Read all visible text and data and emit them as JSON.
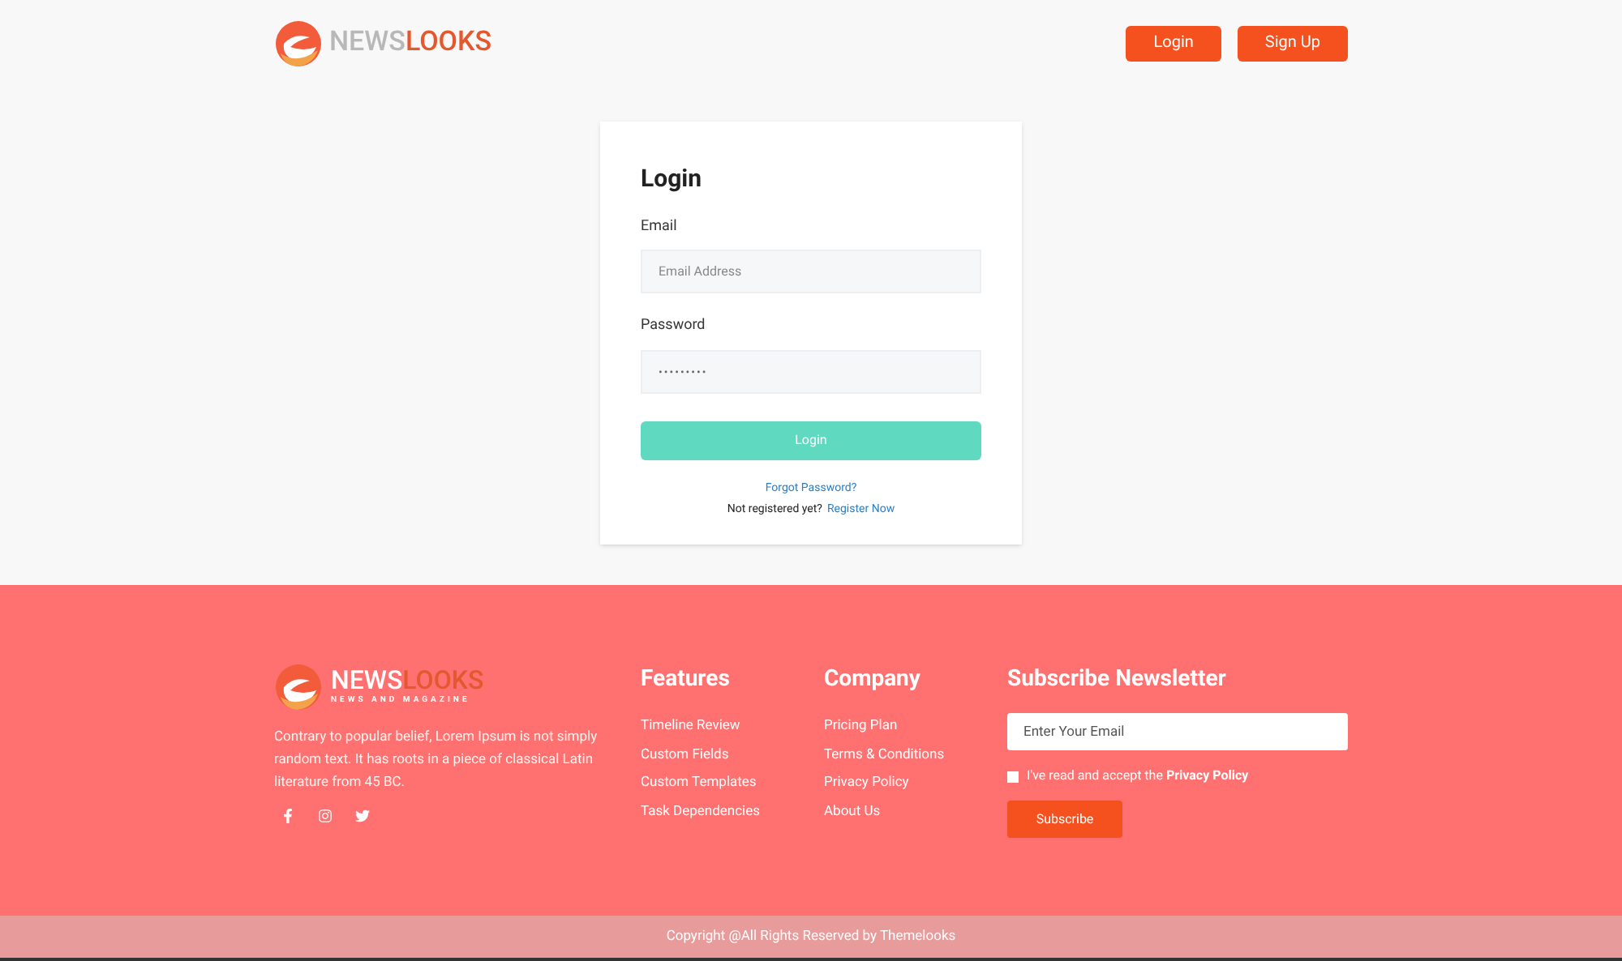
{
  "header": {
    "logo": {
      "part1": "NEWS",
      "part2": "LOOKS"
    },
    "buttons": [
      "Login",
      "Sign Up"
    ]
  },
  "login": {
    "title": "Login",
    "fields": [
      {
        "label": "Email",
        "placeholder": "Email Address",
        "kind": "text"
      },
      {
        "label": "Password",
        "value": "•••••••••",
        "kind": "password"
      }
    ],
    "submit": "Login",
    "forgot": "Forgot Password?",
    "register_prompt": "Not registered yet?",
    "register_link": "Register Now"
  },
  "footer": {
    "logo": {
      "part1": "NEWS",
      "part2": "LOOKS",
      "tagline": "NEWS AND MAGAZINE"
    },
    "about": "Contrary to popular belief, Lorem Ipsum is not simply random text. It has roots in a piece of classical Latin literature from 45 BC.",
    "social": [
      {
        "kind": "facebook"
      },
      {
        "kind": "instagram"
      },
      {
        "kind": "twitter"
      }
    ],
    "columns": [
      {
        "title": "Features",
        "links": [
          "Timeline Review",
          "Custom Fields",
          "Custom Templates",
          "Task Dependencies"
        ]
      },
      {
        "title": "Company",
        "links": [
          "Pricing Plan",
          "Terms & Conditions",
          "Privacy Policy",
          "About Us"
        ]
      }
    ],
    "newsletter": {
      "title": "Subscribe Newsletter",
      "placeholder": "Enter Your Email",
      "consent": "I've read and accept the **Privacy Policy**",
      "checked": false,
      "button": "Subscribe"
    }
  },
  "copyright": "Copyright @All Rights Reserved by Themelooks"
}
